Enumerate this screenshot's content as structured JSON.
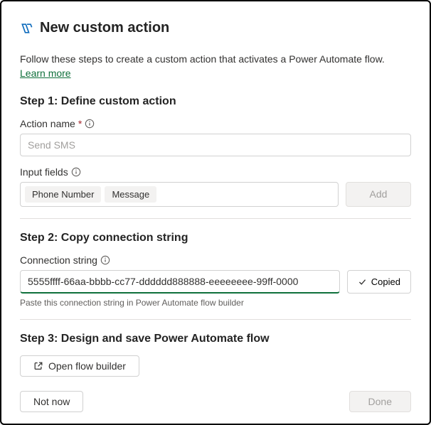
{
  "header": {
    "title": "New custom action"
  },
  "intro": {
    "text": "Follow these steps to create a custom action that activates a Power Automate flow. ",
    "link": "Learn more"
  },
  "step1": {
    "title": "Step 1: Define custom action",
    "action_name_label": "Action name",
    "action_name_placeholder": "Send SMS",
    "input_fields_label": "Input fields",
    "chips": [
      "Phone Number",
      "Message"
    ],
    "add_button": "Add"
  },
  "step2": {
    "title": "Step 2: Copy connection string",
    "connection_label": "Connection string",
    "connection_value": "5555ffff-66aa-bbbb-cc77-dddddd888888-eeeeeeee-99ff-0000",
    "copied_button": "Copied",
    "helper": "Paste this connection string in Power Automate flow builder"
  },
  "step3": {
    "title": "Step 3: Design and save Power Automate flow",
    "open_flow": "Open flow builder"
  },
  "footer": {
    "not_now": "Not now",
    "done": "Done"
  }
}
